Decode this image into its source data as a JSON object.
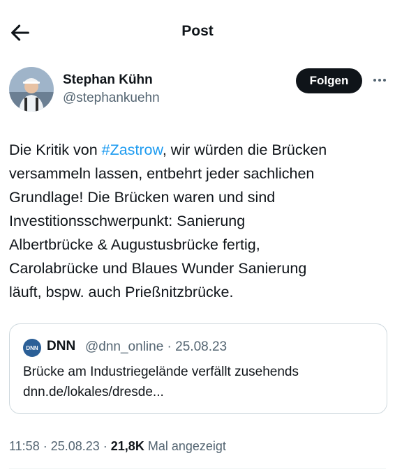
{
  "header": {
    "title": "Post"
  },
  "author": {
    "name": "Stephan Kühn",
    "handle": "@stephankuehn",
    "follow_label": "Folgen"
  },
  "tweet": {
    "text_before": "Die Kritik von ",
    "hashtag": "#Zastrow",
    "text_after": ", wir würden die Brücken\nversammeln lassen, entbehrt jeder sachlichen\nGrundlage! Die Brücken waren und sind\nInvestitionsschwerpunkt: Sanierung\nAlbertbrücke & Augustusbrücke fertig,\nCarolabrücke und Blaues Wunder Sanierung\nläuft, bspw. auch Prießnitzbrücke."
  },
  "quote": {
    "logo_text": "DNN",
    "name": "DNN",
    "meta": "@dnn_online · 25.08.23",
    "title": "Brücke am Industriegelände verfällt zusehends",
    "link": "dnn.de/lokales/dresde..."
  },
  "footer": {
    "time_date": "11:58 · 25.08.23 · ",
    "views_count": "21,8K",
    "views_label": " Mal angezeigt"
  }
}
